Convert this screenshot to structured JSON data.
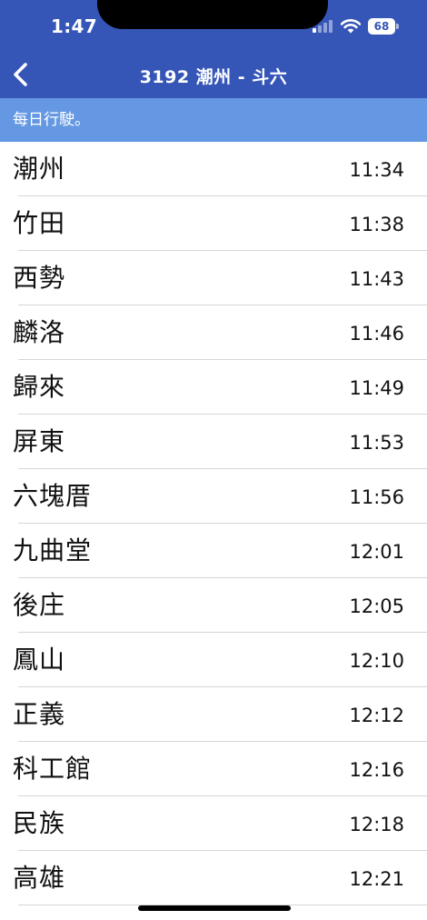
{
  "status_bar": {
    "time": "1:47",
    "battery": "68"
  },
  "nav": {
    "title": "3192 潮州 - 斗六"
  },
  "banner": {
    "text": "每日行駛。"
  },
  "stops": [
    {
      "name": "潮州",
      "time": "11:34"
    },
    {
      "name": "竹田",
      "time": "11:38"
    },
    {
      "name": "西勢",
      "time": "11:43"
    },
    {
      "name": "麟洛",
      "time": "11:46"
    },
    {
      "name": "歸來",
      "time": "11:49"
    },
    {
      "name": "屏東",
      "time": "11:53"
    },
    {
      "name": "六塊厝",
      "time": "11:56"
    },
    {
      "name": "九曲堂",
      "time": "12:01"
    },
    {
      "name": "後庄",
      "time": "12:05"
    },
    {
      "name": "鳳山",
      "time": "12:10"
    },
    {
      "name": "正義",
      "time": "12:12"
    },
    {
      "name": "科工館",
      "time": "12:16"
    },
    {
      "name": "民族",
      "time": "12:18"
    },
    {
      "name": "高雄",
      "time": "12:21"
    }
  ],
  "icons": {
    "back": "chevron-left-icon",
    "signal": "cellular-signal-icon",
    "wifi": "wifi-icon",
    "battery": "battery-icon"
  },
  "colors": {
    "header": "#3556b7",
    "banner": "#6598e3",
    "separator": "#d6d6da"
  }
}
